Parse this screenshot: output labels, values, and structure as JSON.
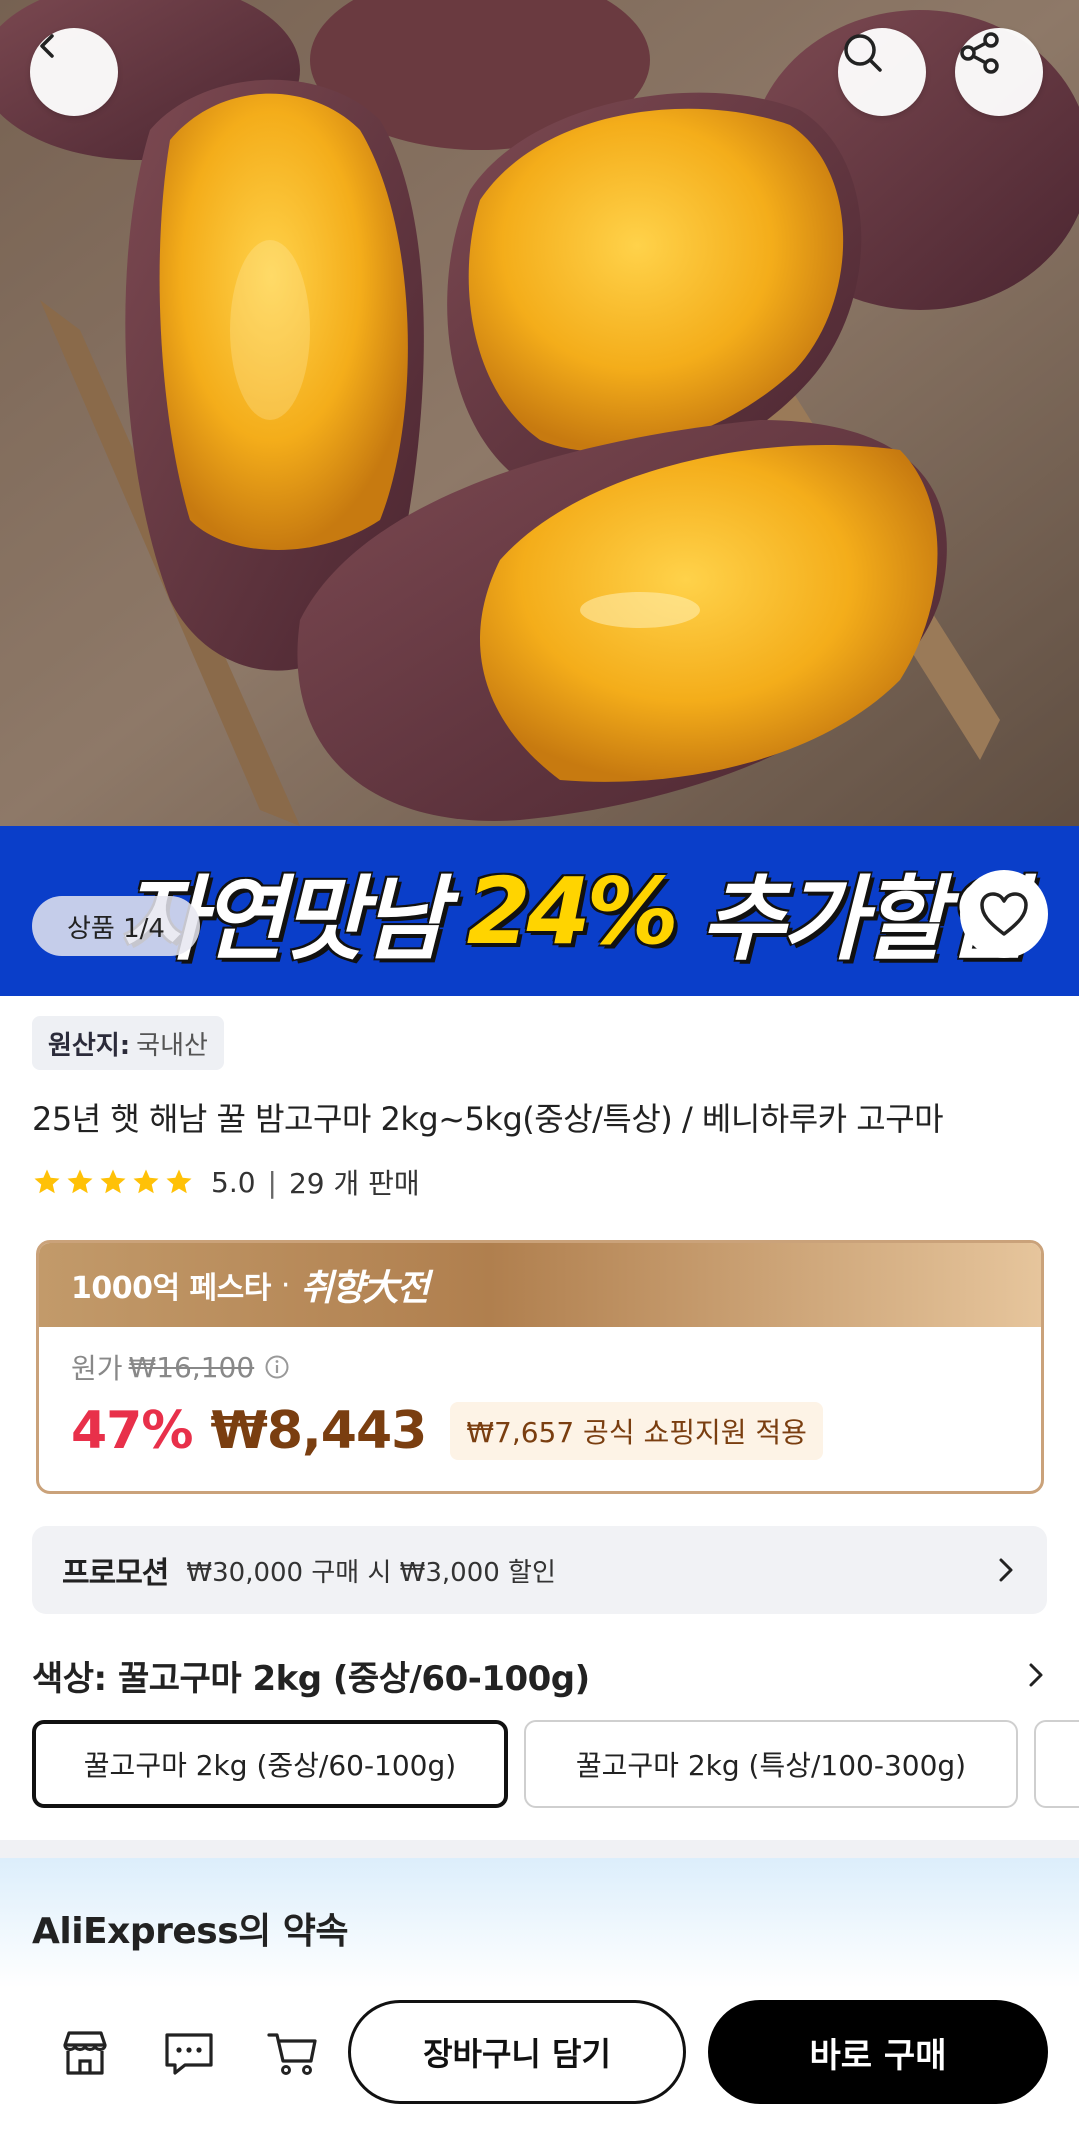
{
  "hero": {
    "page_indicator": "상품 1/4"
  },
  "banner": {
    "text_white": "자연맛남",
    "text_yellow": "24%",
    "text_white2": "추가할인"
  },
  "origin": {
    "label": "원산지:",
    "value": "국내산"
  },
  "product": {
    "title": "25년 햇 해남 꿀 밤고구마 2kg~5kg(중상/특상) / 베니하루카 고구마",
    "rating": "5.0",
    "rating_stars": 5,
    "sold": "29 개 판매"
  },
  "price": {
    "fest_label": "1000억 페스타",
    "fest_dot": "·",
    "fest_logo": "취향大전",
    "original_label": "원가",
    "original_price": "₩16,100",
    "discount": "47%",
    "sale_price": "₩8,443",
    "coupon": "₩7,657 공식 쇼핑지원 적용"
  },
  "promotion": {
    "label": "프로모션",
    "text": "₩30,000 구매 시 ₩3,000 할인"
  },
  "color": {
    "label": "색상: 꿀고구마 2kg (중상/60-100g)",
    "options": [
      "꿀고구마 2kg (중상/60-100g)",
      "꿀고구마 2kg (특상/100-300g)",
      ""
    ],
    "selected_index": 0
  },
  "promise": {
    "title": "AliExpress의 약속"
  },
  "bottom": {
    "add_to_cart": "장바구니 담기",
    "buy_now": "바로 구매"
  },
  "colors": {
    "banner_blue": "#0a3ec9",
    "banner_yellow": "#ffd400",
    "discount_red": "#e8304a",
    "price_brown": "#7a3e10",
    "star_yellow": "#ffc107"
  },
  "icons": [
    "back-arrow-icon",
    "search-icon",
    "share-icon",
    "heart-icon",
    "star-icon",
    "info-icon",
    "chevron-right-icon",
    "store-icon",
    "chat-icon",
    "cart-icon"
  ]
}
